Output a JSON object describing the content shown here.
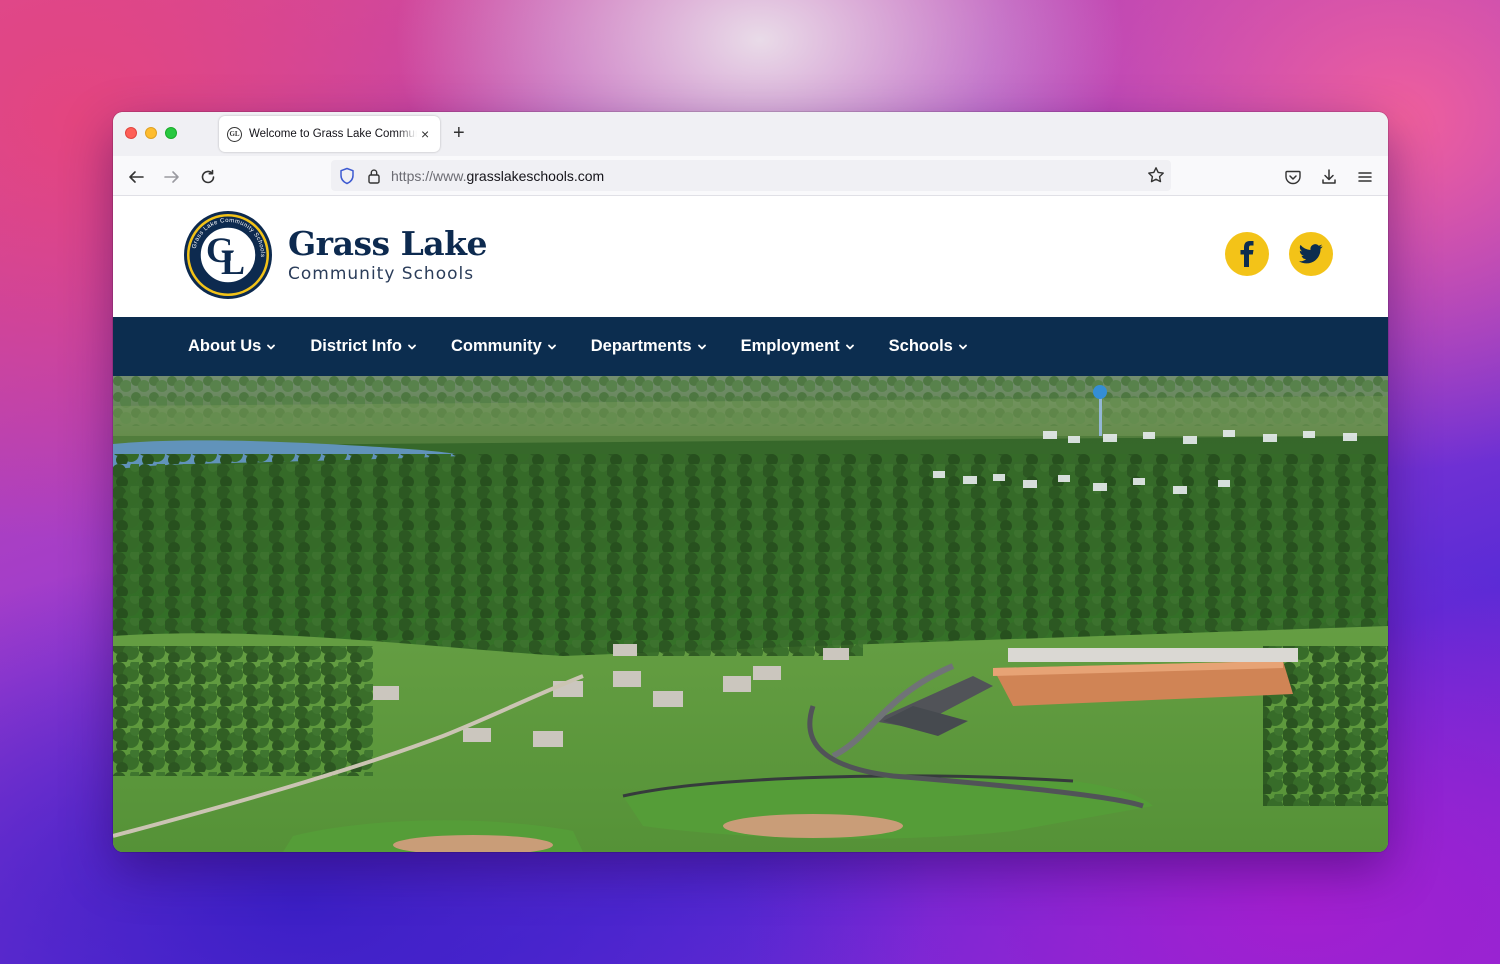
{
  "browser": {
    "tab": {
      "title": "Welcome to Grass Lake Community Schools",
      "favicon_text": "GL",
      "close_glyph": "×"
    },
    "new_tab_glyph": "+",
    "url": {
      "prefix": "https://www.",
      "domain": "grasslakeschools.com"
    }
  },
  "site": {
    "logo": {
      "initials_top": "G",
      "initials_bottom": "L",
      "seal_text": "Grass Lake Community Schools"
    },
    "brand_title": "Grass Lake",
    "brand_subtitle": "Community Schools",
    "social": [
      "facebook-icon",
      "twitter-icon"
    ],
    "accent_color": "#f3c318",
    "navy_color": "#0c2d4f",
    "nav": [
      {
        "label": "About Us"
      },
      {
        "label": "District Info"
      },
      {
        "label": "Community"
      },
      {
        "label": "Departments"
      },
      {
        "label": "Employment"
      },
      {
        "label": "Schools"
      }
    ]
  }
}
